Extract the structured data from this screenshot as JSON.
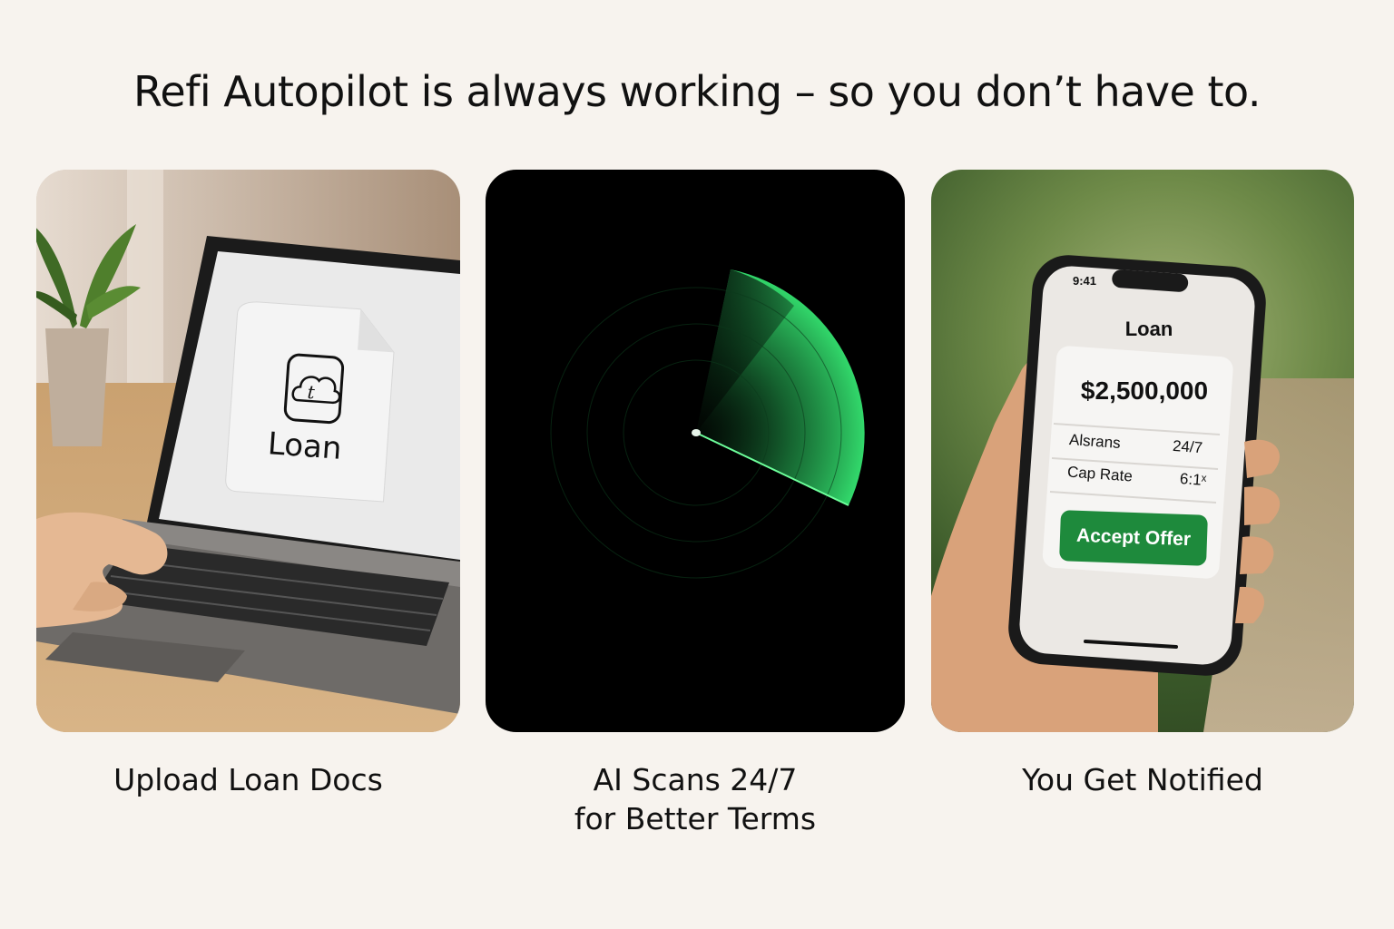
{
  "headline": "Refi Autopilot is always working – so you don’t have to.",
  "steps": [
    {
      "caption_lines": [
        "Upload Loan Docs"
      ],
      "document_label": "Loan",
      "icon": "upload-cloud-document-icon"
    },
    {
      "caption_lines": [
        "AI Scans 24/7",
        "for Better Terms"
      ],
      "visual": "radar-scan",
      "accent_color": "#2fd86a"
    },
    {
      "caption_lines": [
        "You Get Notified"
      ],
      "phone": {
        "time": "9:41",
        "title": "Loan",
        "amount": "$2,500,000",
        "rows": [
          {
            "label": "Alsrans",
            "value": "24/7"
          },
          {
            "label": "Cap Rate",
            "value": "6:1ˣ"
          }
        ],
        "button_label": "Accept Offer",
        "button_color": "#1e8a3c"
      }
    }
  ]
}
